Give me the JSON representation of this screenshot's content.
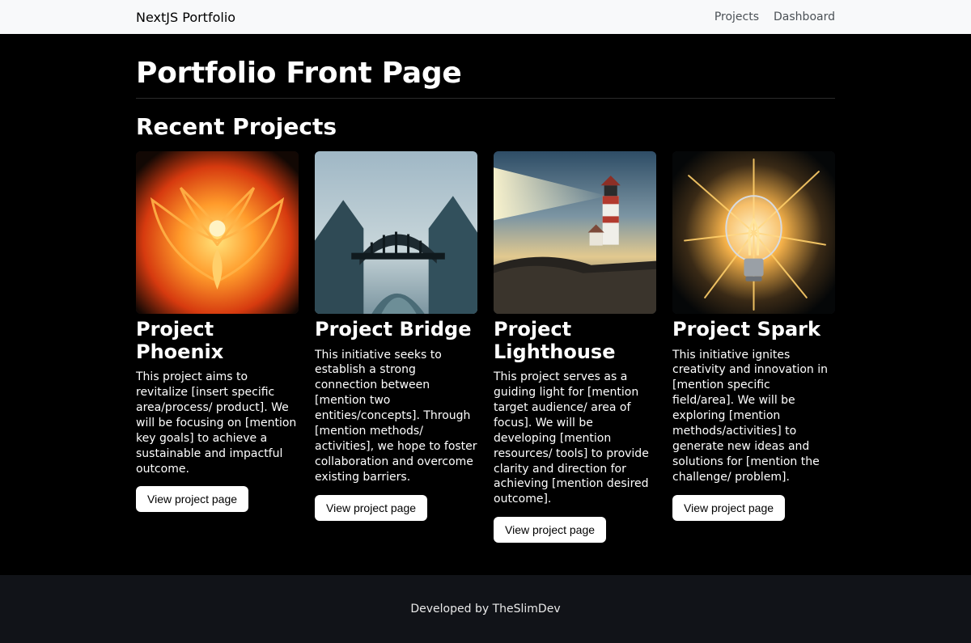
{
  "nav": {
    "brand": "NextJS Portfolio",
    "links": {
      "projects": "Projects",
      "dashboard": "Dashboard"
    }
  },
  "main": {
    "title": "Portfolio Front Page",
    "section_title": "Recent Projects",
    "view_button": "View project page"
  },
  "projects": [
    {
      "title": "Project Phoenix",
      "desc": "This project aims to revitalize [insert specific area/process/ product]. We will be focusing on [mention key goals] to achieve a sustainable and impactful outcome.",
      "image_alt": "phoenix-illustration"
    },
    {
      "title": "Project Bridge",
      "desc": "This initiative seeks to establish a strong connection between [mention two entities/concepts]. Through [mention methods/ activities], we hope to foster collaboration and overcome existing barriers.",
      "image_alt": "bridge-illustration"
    },
    {
      "title": "Project Lighthouse",
      "desc": "This project serves as a guiding light for [mention target audience/ area of focus]. We will be developing [mention resources/ tools] to provide clarity and direction for achieving [mention desired outcome].",
      "image_alt": "lighthouse-illustration"
    },
    {
      "title": "Project Spark",
      "desc": "This initiative ignites creativity and innovation in [mention specific field/area]. We will be exploring [mention methods/activities] to generate new ideas and solutions for [mention the challenge/ problem].",
      "image_alt": "spark-illustration"
    }
  ],
  "footer": {
    "text": "Developed by TheSlimDev"
  }
}
